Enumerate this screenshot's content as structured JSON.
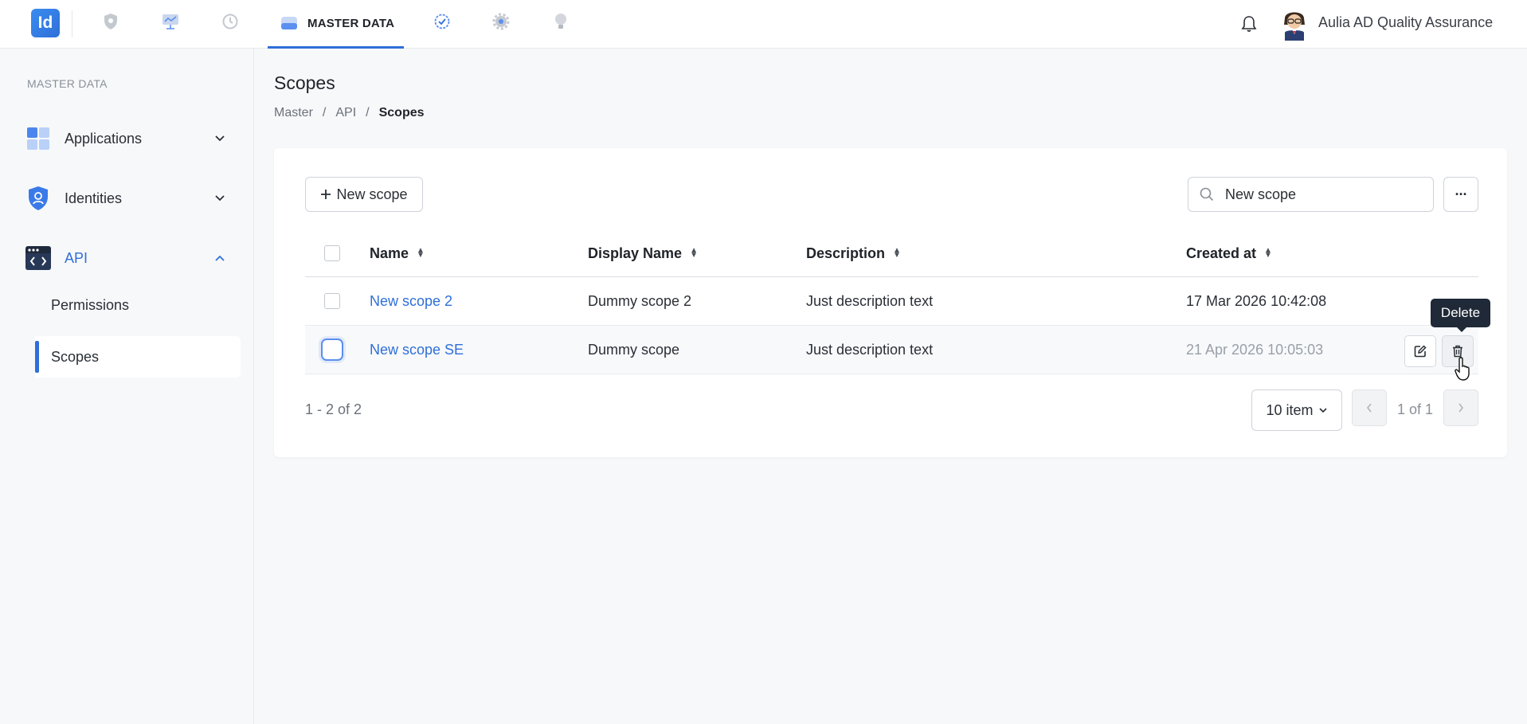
{
  "app": {
    "logo_text": "Id",
    "user_name": "Aulia AD Quality Assurance"
  },
  "topnav": {
    "items": [
      {
        "icon": "shield-icon"
      },
      {
        "icon": "dashboard-icon"
      },
      {
        "icon": "history-icon"
      },
      {
        "icon": "master-data-icon",
        "label": "MASTER DATA",
        "active": true
      },
      {
        "icon": "check-badge-icon"
      },
      {
        "icon": "gear-icon"
      },
      {
        "icon": "lightbulb-icon"
      }
    ]
  },
  "sidebar": {
    "section_label": "MASTER DATA",
    "items": [
      {
        "label": "Applications",
        "icon": "applications-icon",
        "expanded": false
      },
      {
        "label": "Identities",
        "icon": "identity-shield-icon",
        "expanded": false
      },
      {
        "label": "API",
        "icon": "code-window-icon",
        "expanded": true
      }
    ],
    "sub_items": [
      {
        "label": "Permissions",
        "active": false
      },
      {
        "label": "Scopes",
        "active": true
      }
    ]
  },
  "page": {
    "title": "Scopes",
    "breadcrumb": [
      "Master",
      "API",
      "Scopes"
    ],
    "breadcrumb_sep": "/"
  },
  "toolbar": {
    "new_button_label": "New scope",
    "search_value": "New scope",
    "more_label": "···"
  },
  "table": {
    "columns": [
      "Name",
      "Display Name",
      "Description",
      "Created at"
    ],
    "rows": [
      {
        "name": "New scope 2",
        "display_name": "Dummy scope 2",
        "description": "Just description text",
        "created_at": "17 Mar 2026 10:42:08"
      },
      {
        "name": "New scope SE",
        "display_name": "Dummy scope",
        "description": "Just description text",
        "created_at": "21 Apr 2026 10:05:03"
      }
    ],
    "tooltip": "Delete"
  },
  "pagination": {
    "summary": "1 - 2 of 2",
    "page_size": "10 item",
    "page_text": "1 of 1"
  },
  "colors": {
    "accent": "#2f6fd8",
    "tooltip_bg": "#1f2937"
  }
}
